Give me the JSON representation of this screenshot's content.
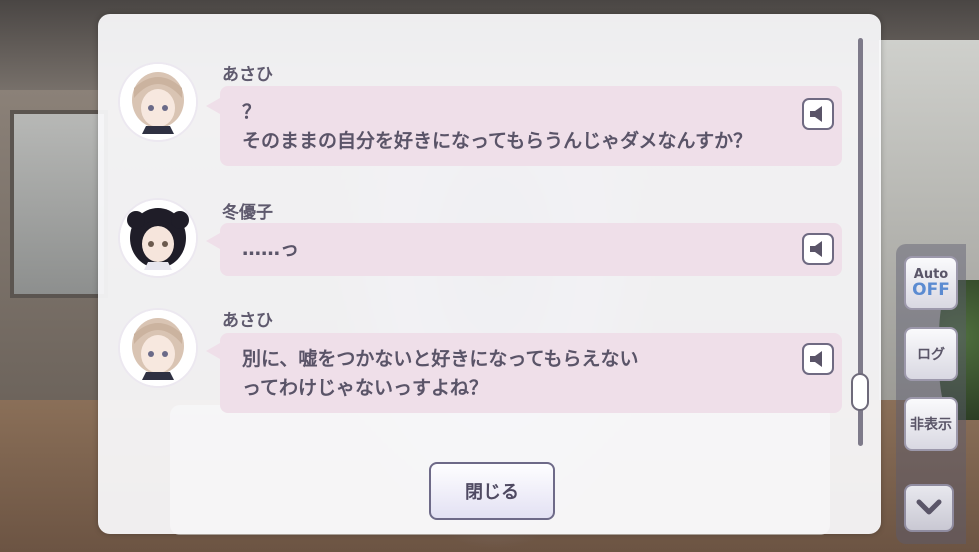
{
  "log": {
    "entries": [
      {
        "speaker": "あさひ",
        "text": "？\nそのままの自分を好きになってもらうんじゃダメなんすか？",
        "avatar": "asahi-avatar"
      },
      {
        "speaker": "冬優子",
        "text": "……っ",
        "avatar": "fuyuko-avatar"
      },
      {
        "speaker": "あさひ",
        "text": "別に、嘘をつかないと好きになってもらえない\nってわけじゃないっすよね？",
        "avatar": "asahi-avatar"
      }
    ],
    "voice_icon": "speaker-icon",
    "close_label": "閉じる"
  },
  "side_menu": {
    "auto_label": "Auto",
    "auto_state": "OFF",
    "log_label": "ログ",
    "hide_label": "非表示",
    "down_icon": "chevron-down-icon"
  },
  "colors": {
    "bubble": "#efdfe9",
    "text": "#5a5468",
    "accent": "#5b8bd1"
  }
}
